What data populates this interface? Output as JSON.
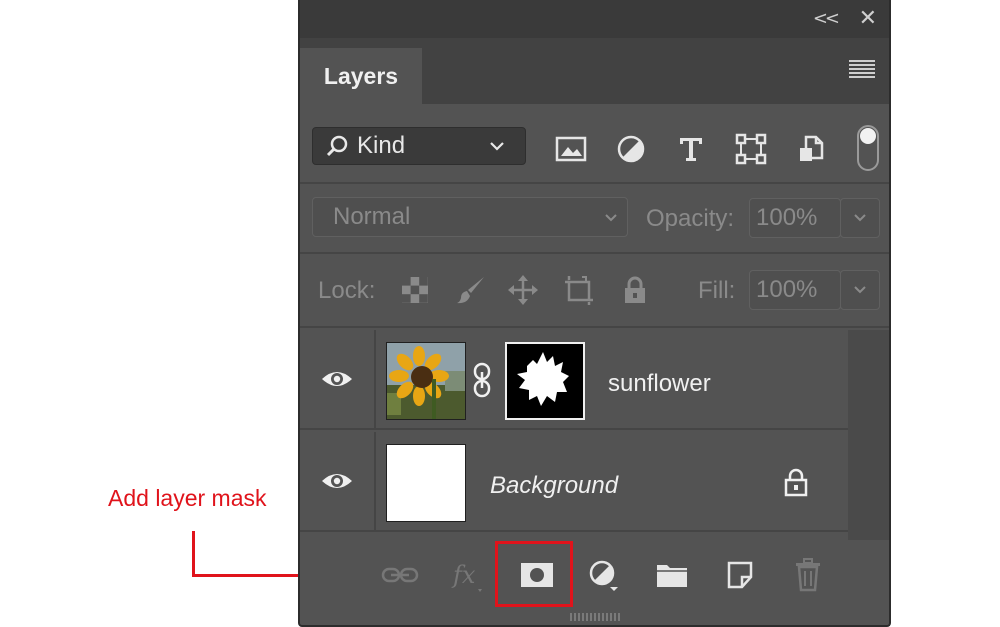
{
  "panel": {
    "tab_title": "Layers",
    "kind_label": "Kind",
    "blend_mode": "Normal",
    "opacity_label": "Opacity:",
    "opacity_value": "100%",
    "lock_label": "Lock:",
    "fill_label": "Fill:",
    "fill_value": "100%"
  },
  "layers": [
    {
      "name": "sunflower",
      "visible": true,
      "has_mask": true,
      "locked": false
    },
    {
      "name": "Background",
      "visible": true,
      "has_mask": false,
      "locked": true,
      "italic": true
    }
  ],
  "callout": {
    "label": "Add layer mask",
    "color": "#e0131b"
  },
  "icons": {
    "filter": [
      "image-icon",
      "adjustment-icon",
      "type-icon",
      "shape-icon",
      "smart-object-icon"
    ],
    "lock": [
      "lock-transparent-icon",
      "lock-pixels-icon",
      "lock-position-icon",
      "lock-artboard-icon",
      "lock-all-icon"
    ],
    "bottom": [
      "link-layers-icon",
      "fx-icon",
      "add-layer-mask-icon",
      "new-adjustment-icon",
      "new-group-icon",
      "new-layer-icon",
      "delete-layer-icon"
    ]
  }
}
